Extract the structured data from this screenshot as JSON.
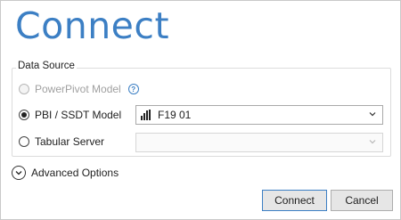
{
  "dialog": {
    "title": "Connect"
  },
  "data_source": {
    "legend": "Data Source",
    "options": [
      {
        "label": "PowerPivot Model",
        "selected": false,
        "enabled": false,
        "help_icon": "question-circle-icon"
      },
      {
        "label": "PBI / SSDT Model",
        "selected": true,
        "enabled": true,
        "dropdown_value": "F19 01",
        "dropdown_icon": "power-bi-icon"
      },
      {
        "label": "Tabular Server",
        "selected": false,
        "enabled": true,
        "dropdown_value": ""
      }
    ]
  },
  "advanced": {
    "label": "Advanced Options",
    "icon": "chevron-down-circle-icon"
  },
  "buttons": {
    "connect": "Connect",
    "cancel": "Cancel"
  },
  "colors": {
    "title": "#3c7fc4",
    "accent": "#3c7fc4"
  }
}
